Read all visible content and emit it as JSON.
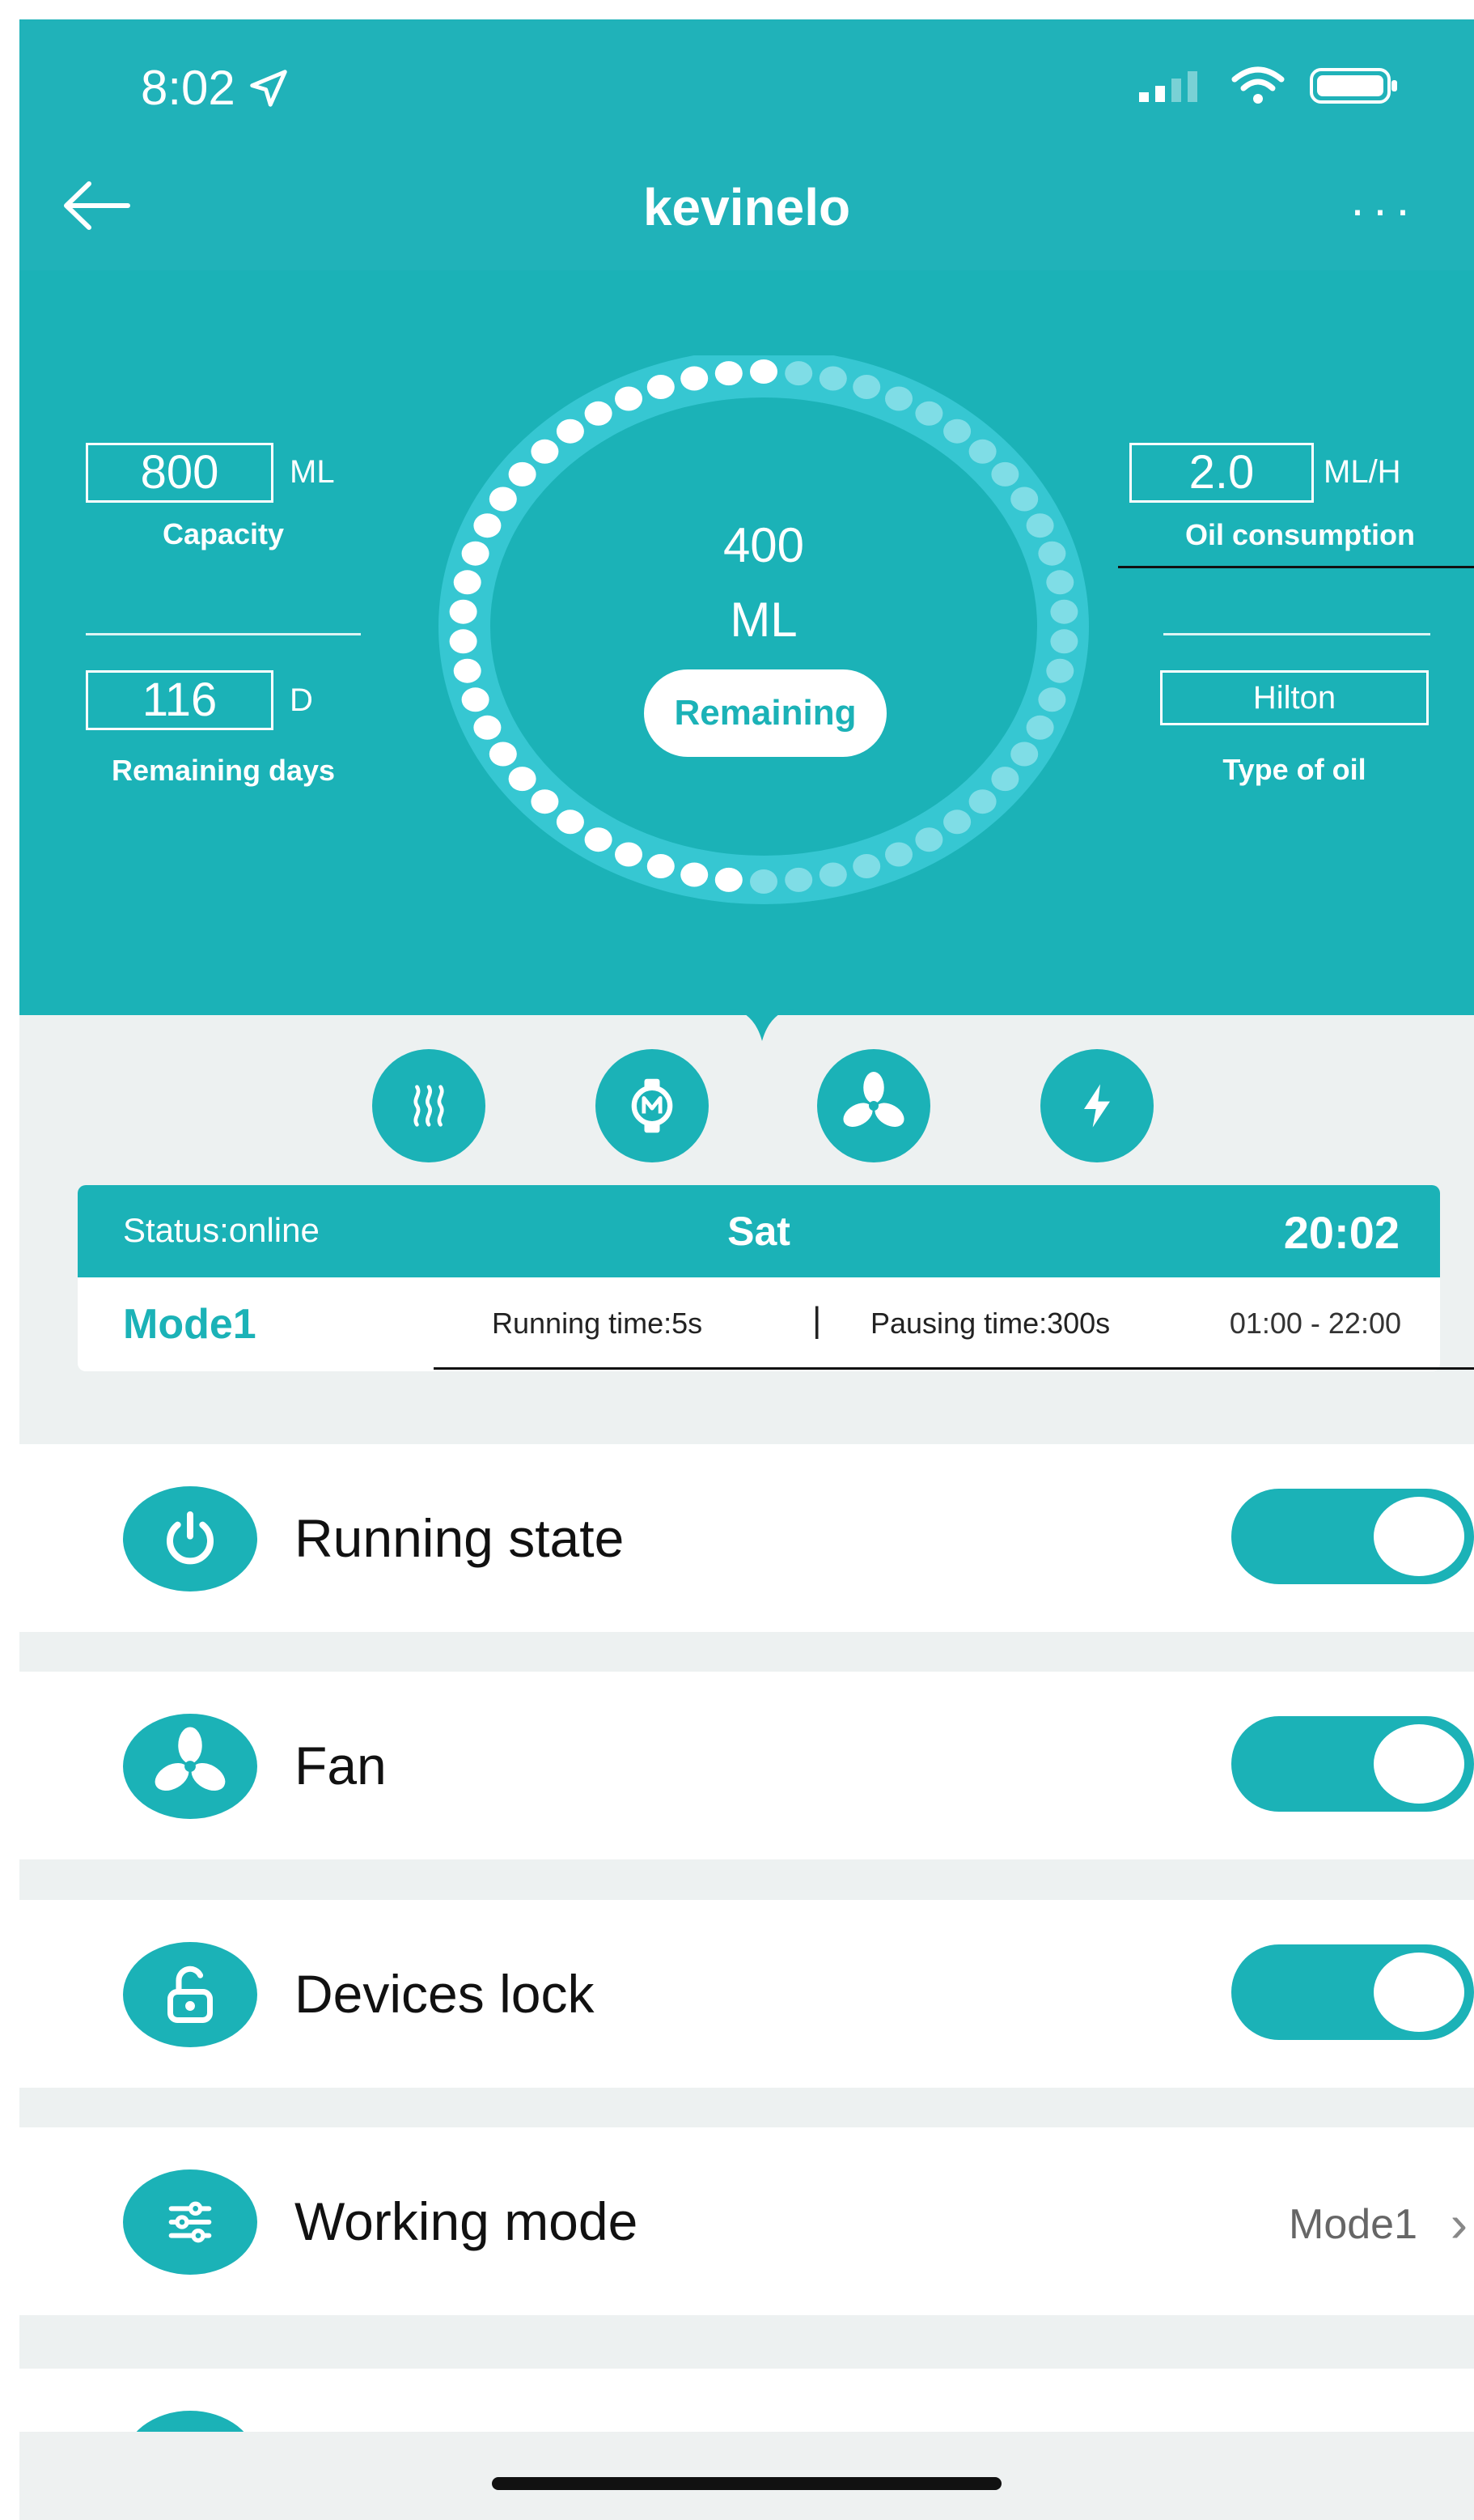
{
  "status_bar": {
    "time": "8:02"
  },
  "nav": {
    "title": "kevinelo",
    "more": "···"
  },
  "panel": {
    "capacity": {
      "value": "800",
      "unit": "ML",
      "label": "Capacity"
    },
    "remaining_days": {
      "value": "116",
      "unit": "D",
      "label": "Remaining days"
    },
    "oil_consumption": {
      "value": "2.0",
      "unit": "ML/H",
      "label": "Oil consumption"
    },
    "oil_type": {
      "value": "Hilton",
      "label": "Type of oil"
    },
    "gauge": {
      "amount": "400",
      "unit": "ML",
      "label": "Remaining",
      "fill_fraction": 0.5
    }
  },
  "features": [
    {
      "icon": "heat-icon"
    },
    {
      "icon": "watch-icon"
    },
    {
      "icon": "fan-icon"
    },
    {
      "icon": "power-bolt-icon"
    }
  ],
  "status_card": {
    "status": "Status:online",
    "day": "Sat",
    "time": "20:02",
    "mode": "Mode1",
    "running_time": "Running time:5s",
    "separator": "|",
    "pausing_time": "Pausing time:300s",
    "hours": "01:00 - 22:00"
  },
  "settings": {
    "running_state": {
      "label": "Running state",
      "on": true,
      "icon": "power-icon"
    },
    "fan": {
      "label": "Fan",
      "on": true,
      "icon": "fan-icon"
    },
    "devices_lock": {
      "label": "Devices lock",
      "on": true,
      "icon": "lock-open-icon"
    },
    "working_mode": {
      "label": "Working mode",
      "value": "Mode1",
      "icon": "sliders-icon"
    },
    "devices_address": {
      "icon": "location-icon"
    }
  },
  "colors": {
    "accent": "#1bb2b7",
    "background": "#edf1f1"
  }
}
